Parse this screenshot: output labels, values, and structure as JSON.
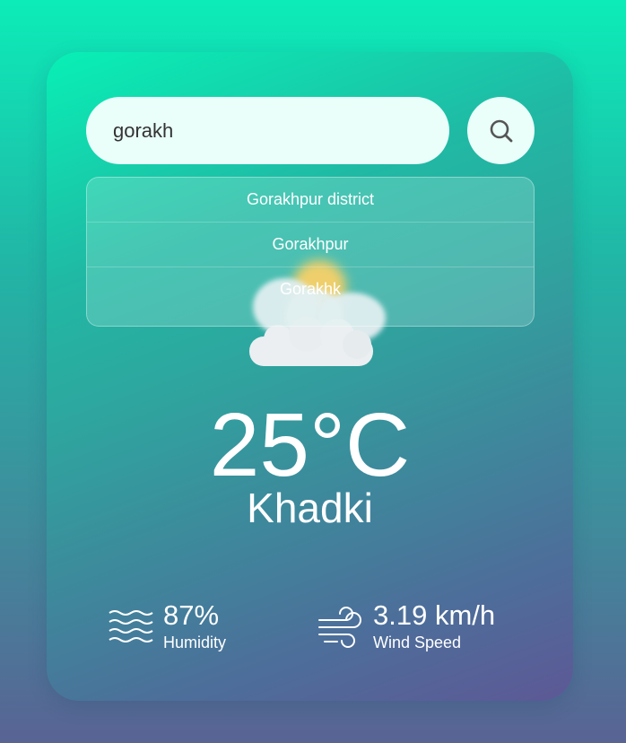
{
  "search": {
    "value": "gorakh"
  },
  "suggestions": [
    {
      "label": "Gorakhpur district"
    },
    {
      "label": "Gorakhpur"
    },
    {
      "label": "Gorakhk"
    }
  ],
  "weather": {
    "icon": "partly-cloudy-sun-icon",
    "temperature": "25°C",
    "city": "Khadki"
  },
  "humidity": {
    "icon": "humidity-waves-icon",
    "value": "87%",
    "label": "Humidity"
  },
  "wind": {
    "icon": "wind-icon",
    "value": "3.19 km/h",
    "label": "Wind Speed"
  }
}
